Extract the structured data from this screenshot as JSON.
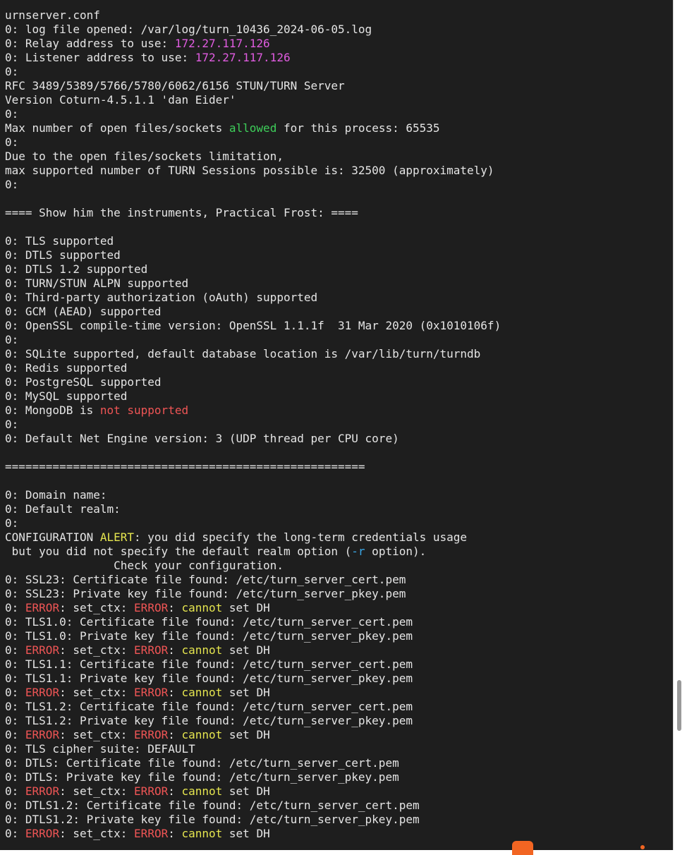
{
  "terminal": {
    "lines": [
      [
        {
          "t": "urnserver.conf",
          "c": "normal"
        }
      ],
      [
        {
          "t": "0: log file opened: /var/log/turn_10436_2024-06-05.log",
          "c": "normal"
        }
      ],
      [
        {
          "t": "0: Relay address to use: ",
          "c": "normal"
        },
        {
          "t": "172.27.117.126",
          "c": "magenta"
        }
      ],
      [
        {
          "t": "0: Listener address to use: ",
          "c": "normal"
        },
        {
          "t": "172.27.117.126",
          "c": "magenta"
        }
      ],
      [
        {
          "t": "0:",
          "c": "normal"
        }
      ],
      [
        {
          "t": "RFC 3489/5389/5766/5780/6062/6156 STUN/TURN Server",
          "c": "normal"
        }
      ],
      [
        {
          "t": "Version Coturn-4.5.1.1 'dan Eider'",
          "c": "normal"
        }
      ],
      [
        {
          "t": "0:",
          "c": "normal"
        }
      ],
      [
        {
          "t": "Max number of open files/sockets ",
          "c": "normal"
        },
        {
          "t": "allowed",
          "c": "green"
        },
        {
          "t": " for this process: 65535",
          "c": "normal"
        }
      ],
      [
        {
          "t": "0:",
          "c": "normal"
        }
      ],
      [
        {
          "t": "Due to the open files/sockets limitation,",
          "c": "normal"
        }
      ],
      [
        {
          "t": "max supported number of TURN Sessions possible is: 32500 (approximately)",
          "c": "normal"
        }
      ],
      [
        {
          "t": "0:",
          "c": "normal"
        }
      ],
      [
        {
          "t": "",
          "c": "normal"
        }
      ],
      [
        {
          "t": "==== Show him the instruments, Practical Frost: ====",
          "c": "normal"
        }
      ],
      [
        {
          "t": "",
          "c": "normal"
        }
      ],
      [
        {
          "t": "0: TLS supported",
          "c": "normal"
        }
      ],
      [
        {
          "t": "0: DTLS supported",
          "c": "normal"
        }
      ],
      [
        {
          "t": "0: DTLS 1.2 supported",
          "c": "normal"
        }
      ],
      [
        {
          "t": "0: TURN/STUN ALPN supported",
          "c": "normal"
        }
      ],
      [
        {
          "t": "0: Third-party authorization (oAuth) supported",
          "c": "normal"
        }
      ],
      [
        {
          "t": "0: GCM (AEAD) supported",
          "c": "normal"
        }
      ],
      [
        {
          "t": "0: OpenSSL compile-time version: OpenSSL 1.1.1f  31 Mar 2020 (0x1010106f)",
          "c": "normal"
        }
      ],
      [
        {
          "t": "0:",
          "c": "normal"
        }
      ],
      [
        {
          "t": "0: SQLite supported, default database location is /var/lib/turn/turndb",
          "c": "normal"
        }
      ],
      [
        {
          "t": "0: Redis supported",
          "c": "normal"
        }
      ],
      [
        {
          "t": "0: PostgreSQL supported",
          "c": "normal"
        }
      ],
      [
        {
          "t": "0: MySQL supported",
          "c": "normal"
        }
      ],
      [
        {
          "t": "0: MongoDB is ",
          "c": "normal"
        },
        {
          "t": "not supported",
          "c": "red"
        }
      ],
      [
        {
          "t": "0:",
          "c": "normal"
        }
      ],
      [
        {
          "t": "0: Default Net Engine version: 3 (UDP thread per CPU core)",
          "c": "normal"
        }
      ],
      [
        {
          "t": "",
          "c": "normal"
        }
      ],
      [
        {
          "t": "=====================================================",
          "c": "normal"
        }
      ],
      [
        {
          "t": "",
          "c": "normal"
        }
      ],
      [
        {
          "t": "0: Domain name:",
          "c": "normal"
        }
      ],
      [
        {
          "t": "0: Default realm:",
          "c": "normal"
        }
      ],
      [
        {
          "t": "0:",
          "c": "normal"
        }
      ],
      [
        {
          "t": "CONFIGURATION ",
          "c": "normal"
        },
        {
          "t": "ALERT",
          "c": "yellow"
        },
        {
          "t": ": you did specify the long-term credentials usage",
          "c": "normal"
        }
      ],
      [
        {
          "t": " but you did not specify the default realm option (",
          "c": "normal"
        },
        {
          "t": "-r",
          "c": "cyan"
        },
        {
          "t": " option).",
          "c": "normal"
        }
      ],
      [
        {
          "t": "                Check your configuration.",
          "c": "normal"
        }
      ],
      [
        {
          "t": "0: SSL23: Certificate file found: /etc/turn_server_cert.pem",
          "c": "normal"
        }
      ],
      [
        {
          "t": "0: SSL23: Private key file found: /etc/turn_server_pkey.pem",
          "c": "normal"
        }
      ],
      [
        {
          "t": "0: ",
          "c": "normal"
        },
        {
          "t": "ERROR",
          "c": "red"
        },
        {
          "t": ": set_ctx: ",
          "c": "normal"
        },
        {
          "t": "ERROR",
          "c": "red"
        },
        {
          "t": ": ",
          "c": "normal"
        },
        {
          "t": "cannot",
          "c": "yellow"
        },
        {
          "t": " set DH",
          "c": "normal"
        }
      ],
      [
        {
          "t": "0: TLS1.0: Certificate file found: /etc/turn_server_cert.pem",
          "c": "normal"
        }
      ],
      [
        {
          "t": "0: TLS1.0: Private key file found: /etc/turn_server_pkey.pem",
          "c": "normal"
        }
      ],
      [
        {
          "t": "0: ",
          "c": "normal"
        },
        {
          "t": "ERROR",
          "c": "red"
        },
        {
          "t": ": set_ctx: ",
          "c": "normal"
        },
        {
          "t": "ERROR",
          "c": "red"
        },
        {
          "t": ": ",
          "c": "normal"
        },
        {
          "t": "cannot",
          "c": "yellow"
        },
        {
          "t": " set DH",
          "c": "normal"
        }
      ],
      [
        {
          "t": "0: TLS1.1: Certificate file found: /etc/turn_server_cert.pem",
          "c": "normal"
        }
      ],
      [
        {
          "t": "0: TLS1.1: Private key file found: /etc/turn_server_pkey.pem",
          "c": "normal"
        }
      ],
      [
        {
          "t": "0: ",
          "c": "normal"
        },
        {
          "t": "ERROR",
          "c": "red"
        },
        {
          "t": ": set_ctx: ",
          "c": "normal"
        },
        {
          "t": "ERROR",
          "c": "red"
        },
        {
          "t": ": ",
          "c": "normal"
        },
        {
          "t": "cannot",
          "c": "yellow"
        },
        {
          "t": " set DH",
          "c": "normal"
        }
      ],
      [
        {
          "t": "0: TLS1.2: Certificate file found: /etc/turn_server_cert.pem",
          "c": "normal"
        }
      ],
      [
        {
          "t": "0: TLS1.2: Private key file found: /etc/turn_server_pkey.pem",
          "c": "normal"
        }
      ],
      [
        {
          "t": "0: ",
          "c": "normal"
        },
        {
          "t": "ERROR",
          "c": "red"
        },
        {
          "t": ": set_ctx: ",
          "c": "normal"
        },
        {
          "t": "ERROR",
          "c": "red"
        },
        {
          "t": ": ",
          "c": "normal"
        },
        {
          "t": "cannot",
          "c": "yellow"
        },
        {
          "t": " set DH",
          "c": "normal"
        }
      ],
      [
        {
          "t": "0: TLS cipher suite: DEFAULT",
          "c": "normal"
        }
      ],
      [
        {
          "t": "0: DTLS: Certificate file found: /etc/turn_server_cert.pem",
          "c": "normal"
        }
      ],
      [
        {
          "t": "0: DTLS: Private key file found: /etc/turn_server_pkey.pem",
          "c": "normal"
        }
      ],
      [
        {
          "t": "0: ",
          "c": "normal"
        },
        {
          "t": "ERROR",
          "c": "red"
        },
        {
          "t": ": set_ctx: ",
          "c": "normal"
        },
        {
          "t": "ERROR",
          "c": "red"
        },
        {
          "t": ": ",
          "c": "normal"
        },
        {
          "t": "cannot",
          "c": "yellow"
        },
        {
          "t": " set DH",
          "c": "normal"
        }
      ],
      [
        {
          "t": "0: DTLS1.2: Certificate file found: /etc/turn_server_cert.pem",
          "c": "normal"
        }
      ],
      [
        {
          "t": "0: DTLS1.2: Private key file found: /etc/turn_server_pkey.pem",
          "c": "normal"
        }
      ],
      [
        {
          "t": "0: ",
          "c": "normal"
        },
        {
          "t": "ERROR",
          "c": "red"
        },
        {
          "t": ": set_ctx: ",
          "c": "normal"
        },
        {
          "t": "ERROR",
          "c": "red"
        },
        {
          "t": ": ",
          "c": "normal"
        },
        {
          "t": "cannot",
          "c": "yellow"
        },
        {
          "t": " set DH",
          "c": "normal"
        }
      ]
    ]
  },
  "colors": {
    "background": "#1e1e1e",
    "normal": "#e5e5e5",
    "magenta": "#e05ce0",
    "green": "#3ecf5a",
    "red": "#ef5555",
    "yellow": "#e5e54f",
    "cyan": "#3aa8e8"
  },
  "scrollbar": {
    "position_fraction": 0.83
  }
}
